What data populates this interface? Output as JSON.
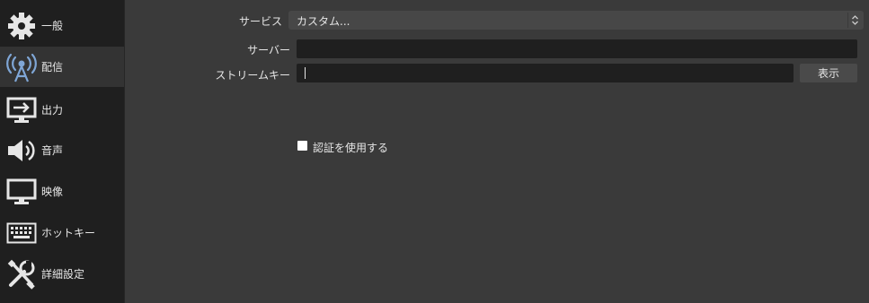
{
  "sidebar": {
    "items": [
      {
        "label": "一般",
        "icon": "gear-icon"
      },
      {
        "label": "配信",
        "icon": "broadcast-antenna-icon",
        "selected": true
      },
      {
        "label": "出力",
        "icon": "monitor-output-icon"
      },
      {
        "label": "音声",
        "icon": "speaker-icon"
      },
      {
        "label": "映像",
        "icon": "monitor-icon"
      },
      {
        "label": "ホットキー",
        "icon": "keyboard-icon"
      },
      {
        "label": "詳細設定",
        "icon": "tools-icon"
      }
    ]
  },
  "stream": {
    "service_label": "サービス",
    "service_value": "カスタム...",
    "server_label": "サーバー",
    "server_value": "",
    "stream_key_label": "ストリームキー",
    "stream_key_value": "",
    "show_button_label": "表示",
    "auth_checkbox_label": "認証を使用する",
    "auth_checked": false
  },
  "colors": {
    "sidebar_bg": "#1f1f1f",
    "panel_bg": "#3a3a3a",
    "field_bg": "#1f1f1f",
    "selected_item_bg": "#333333"
  }
}
